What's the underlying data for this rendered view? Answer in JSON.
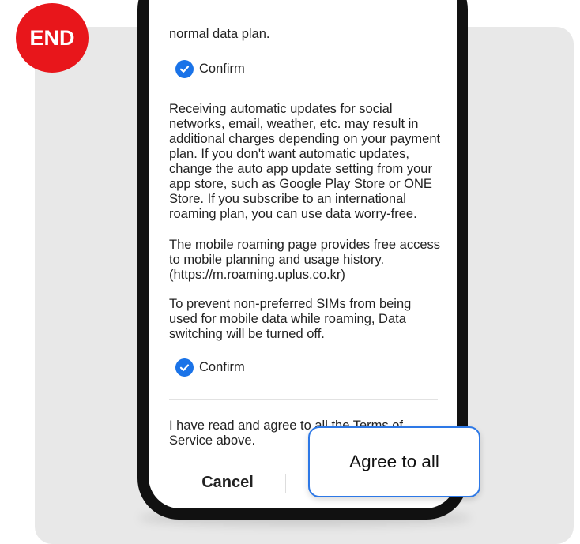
{
  "badge": {
    "label": "END"
  },
  "terms": {
    "para_partial": "normal data plan.",
    "confirm_1": "Confirm",
    "para_updates": "Receiving automatic updates for social networks, email, weather, etc. may result in additional charges depending on your payment plan. If you don't want automatic updates, change the auto app update setting from your app store, such as Google Play Store or ONE Store. If you subscribe to an international roaming plan, you can use data worry-free.",
    "para_roaming_page": "The mobile roaming page provides free access to mobile planning and usage history. (https://m.roaming.uplus.co.kr)",
    "para_sim": "To prevent non-preferred SIMs from being used for mobile data while roaming, Data switching will be turned off.",
    "confirm_2": "Confirm",
    "agree_statement": "I have read and agree to all the Terms of Service above."
  },
  "buttons": {
    "cancel": "Cancel",
    "agree_all": "Agree to all"
  },
  "colors": {
    "badge": "#e8161b",
    "check": "#1a73e8",
    "callout_border": "#2d78e6"
  },
  "icons": {
    "confirm_check": "check-circle-icon"
  }
}
